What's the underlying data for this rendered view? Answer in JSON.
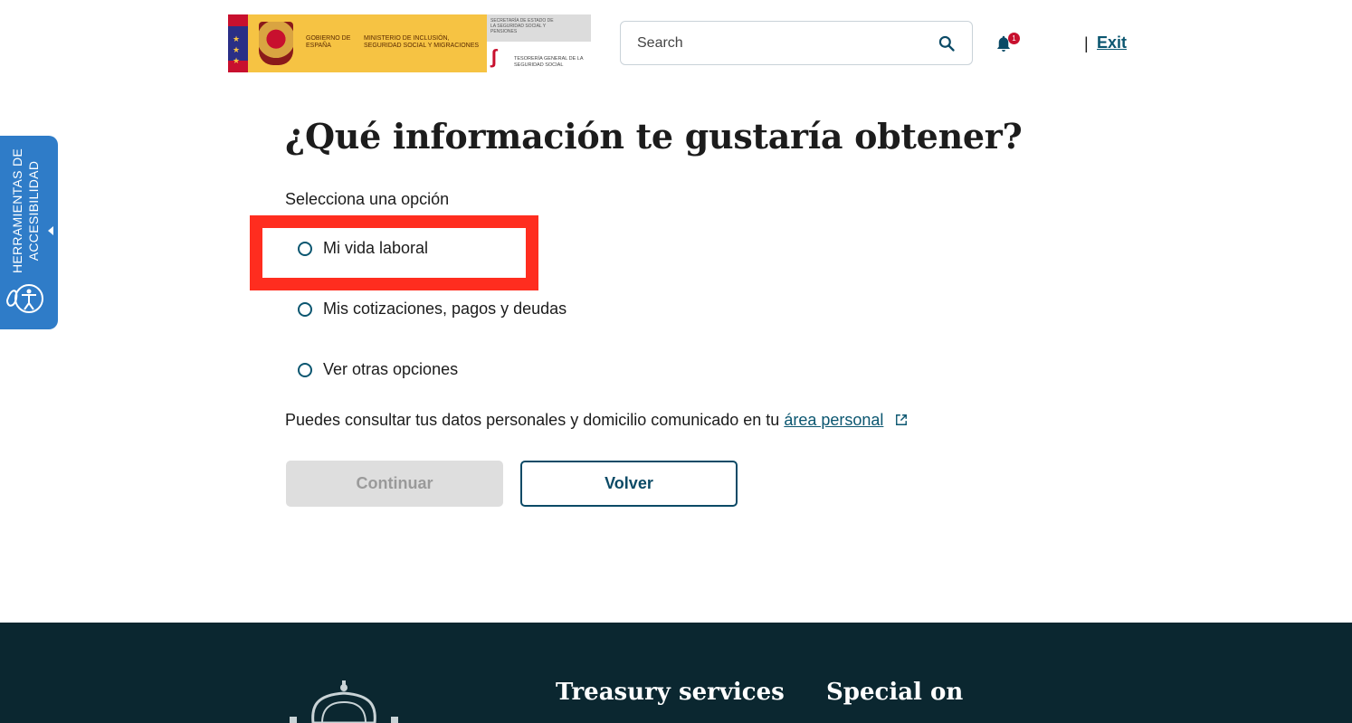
{
  "header": {
    "logo": {
      "gov_text": "GOBIERNO DE ESPAÑA",
      "ministry_text": "MINISTERIO DE INCLUSIÓN, SEGURIDAD SOCIAL Y MIGRACIONES",
      "secretary_text": "SECRETARÍA DE ESTADO DE LA SEGURIDAD SOCIAL Y PENSIONES",
      "treasury_text": "TESORERÍA GENERAL DE LA SEGURIDAD SOCIAL"
    },
    "search_placeholder": "Search",
    "notification_count": "1",
    "separator": "|",
    "exit_label": "Exit"
  },
  "accessibility_tab": {
    "line1": "HERRAMIENTAS DE",
    "line2": "ACCESIBILIDAD"
  },
  "main": {
    "title": "¿Qué información te gustaría obtener?",
    "subtitle": "Selecciona una opción",
    "options": [
      {
        "label": "Mi vida laboral",
        "selected": false
      },
      {
        "label": "Mis cotizaciones, pagos y deudas",
        "selected": false
      },
      {
        "label": "Ver otras opciones",
        "selected": false
      }
    ],
    "info_text": "Puedes consultar tus datos personales y domicilio comunicado en tu",
    "info_link": "área personal",
    "continue_label": "Continuar",
    "back_label": "Volver"
  },
  "footer": {
    "heading1": "Treasury services",
    "heading2": "Special on"
  },
  "colors": {
    "accent": "#0b5670",
    "a11y_tab": "#2f7cc8",
    "highlight": "#ff2d1f",
    "footer_bg": "#0b2730"
  }
}
